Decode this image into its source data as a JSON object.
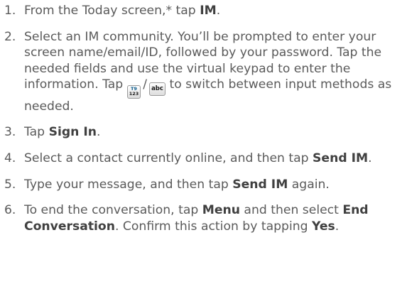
{
  "steps": [
    {
      "number": "1.",
      "parts": [
        "From the Today screen,* tap ",
        "IM",
        "."
      ]
    },
    {
      "number": "2.",
      "text_before": "Select an IM community. You’ll be prompted to enter your screen name/email/ID, followed by your password. Tap the needed fields and use the virtual keypad to enter the information. Tap",
      "key_t9_top": "T9",
      "key_t9_bottom": "123",
      "separator": "/",
      "key_abc": "abc",
      "text_after": "to switch between input methods as needed."
    },
    {
      "number": "3.",
      "parts": [
        "Tap ",
        "Sign In",
        "."
      ]
    },
    {
      "number": "4.",
      "parts": [
        "Select a contact currently online, and then tap ",
        "Send IM",
        "."
      ]
    },
    {
      "number": "5.",
      "parts": [
        "Type your message, and then tap ",
        "Send IM",
        " again."
      ]
    },
    {
      "number": "6.",
      "parts": [
        "To end the conversation, tap ",
        "Menu",
        " and then select ",
        "End Conversation",
        ". Confirm this action by tapping ",
        "Yes",
        "."
      ]
    }
  ]
}
